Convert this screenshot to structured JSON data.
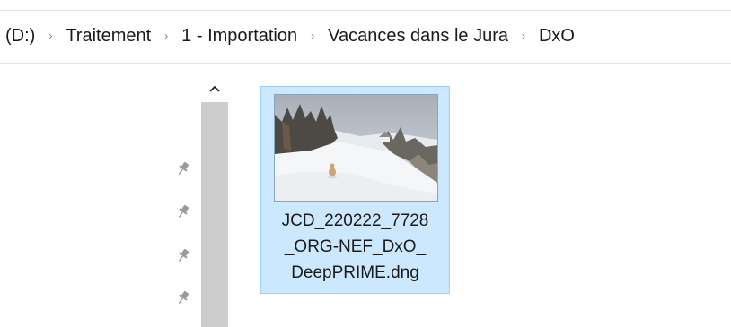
{
  "breadcrumb": {
    "items": [
      {
        "label": "(D:)"
      },
      {
        "label": "Traitement"
      },
      {
        "label": "1 - Importation"
      },
      {
        "label": "Vacances dans le Jura"
      },
      {
        "label": "DxO"
      }
    ],
    "separator": "›"
  },
  "navpane": {
    "scroll_up_glyph": "^",
    "pin_icon": "pin-icon",
    "pin_count": 4
  },
  "file": {
    "name": "JCD_220222_7728\n_ORG-NEF_DxO_\nDeepPRIME.dng",
    "selected": true,
    "selection_color": "#cce8ff"
  }
}
